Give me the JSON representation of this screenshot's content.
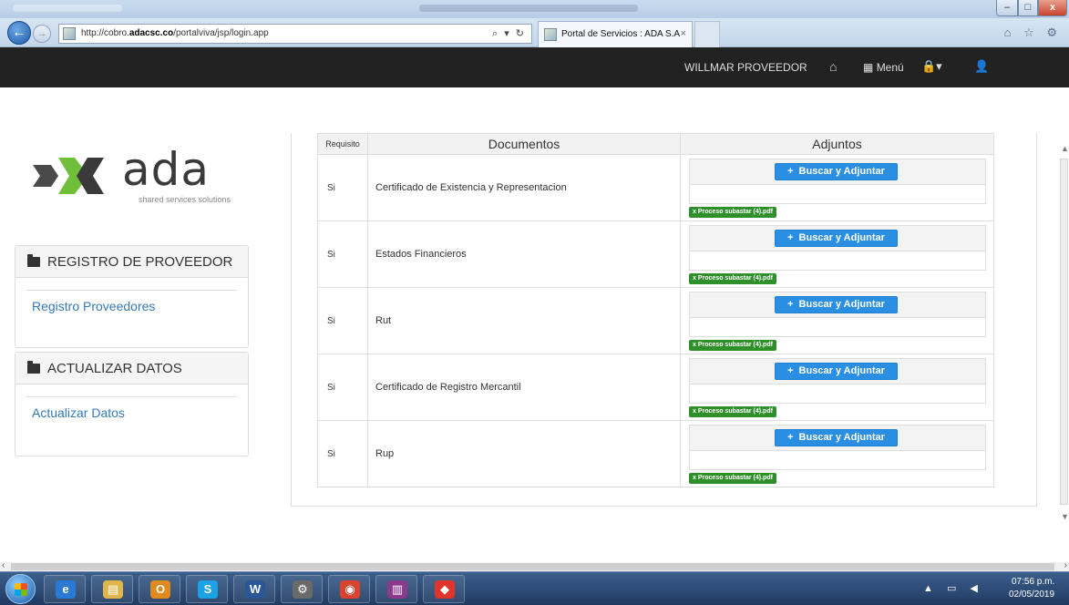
{
  "browser": {
    "address_prefix": "http://cobro.",
    "address_domain": "adacsc.co",
    "address_suffix": "/portalviva/jsp/login.app",
    "address_tools": "⌕ ▾ ↻",
    "tab_title": "Portal de Servicios : ADA S.A",
    "tab_close": "×",
    "back_symbol": "←",
    "forward_symbol": "→",
    "window_buttons": {
      "minimize": "–",
      "maximize": "□",
      "close": "x"
    },
    "ie_tools": "⌂ ☆ ⚙"
  },
  "header": {
    "user_name": "WILLMAR PROVEEDOR",
    "home_icon": "⌂",
    "menu_label": "Menú",
    "menu_icon": "▦",
    "lock_icon": "🔒▾",
    "user_icon": "👤"
  },
  "logo": {
    "word": "ada",
    "tagline": "shared services solutions"
  },
  "sidebar": {
    "panels": [
      {
        "title": "REGISTRO DE PROVEEDOR",
        "link": "Registro Proveedores"
      },
      {
        "title": "ACTUALIZAR DATOS",
        "link": "Actualizar Datos"
      }
    ]
  },
  "table": {
    "headers": {
      "requisito": "Requisito",
      "documentos": "Documentos",
      "adjuntos": "Adjuntos"
    },
    "button_label": "Buscar y Adjuntar",
    "button_icon": "+",
    "rows": [
      {
        "requisito": "Si",
        "documento": "Certificado de Existencia y Representacion",
        "archivo": "Proceso subastar (4).pdf"
      },
      {
        "requisito": "Si",
        "documento": "Estados Financieros",
        "archivo": "Proceso subastar (4).pdf"
      },
      {
        "requisito": "Si",
        "documento": "Rut",
        "archivo": "Proceso subastar (4).pdf"
      },
      {
        "requisito": "Si",
        "documento": "Certificado de Registro Mercantil",
        "archivo": "Proceso subastar (4).pdf"
      },
      {
        "requisito": "Si",
        "documento": "Rup",
        "archivo": "Proceso subastar (4).pdf"
      }
    ],
    "remove_icon": "x"
  },
  "taskbar": {
    "apps": [
      {
        "name": "internet-explorer",
        "glyph": "e",
        "color": "#2a79d4"
      },
      {
        "name": "file-explorer",
        "glyph": "▤",
        "color": "#e0b64a"
      },
      {
        "name": "outlook",
        "glyph": "O",
        "color": "#e0891f"
      },
      {
        "name": "skype",
        "glyph": "S",
        "color": "#1aa1e6"
      },
      {
        "name": "word",
        "glyph": "W",
        "color": "#2b5797"
      },
      {
        "name": "settings",
        "glyph": "⚙",
        "color": "#6a6a6a"
      },
      {
        "name": "chrome",
        "glyph": "◉",
        "color": "#d9422c"
      },
      {
        "name": "winrar",
        "glyph": "▥",
        "color": "#8a3a8c"
      },
      {
        "name": "anydesk",
        "glyph": "◆",
        "color": "#e0342a"
      }
    ],
    "tray": "▲ ▭ ◀",
    "clock_time": "07:56 p.m.",
    "clock_date": "02/05/2019"
  }
}
